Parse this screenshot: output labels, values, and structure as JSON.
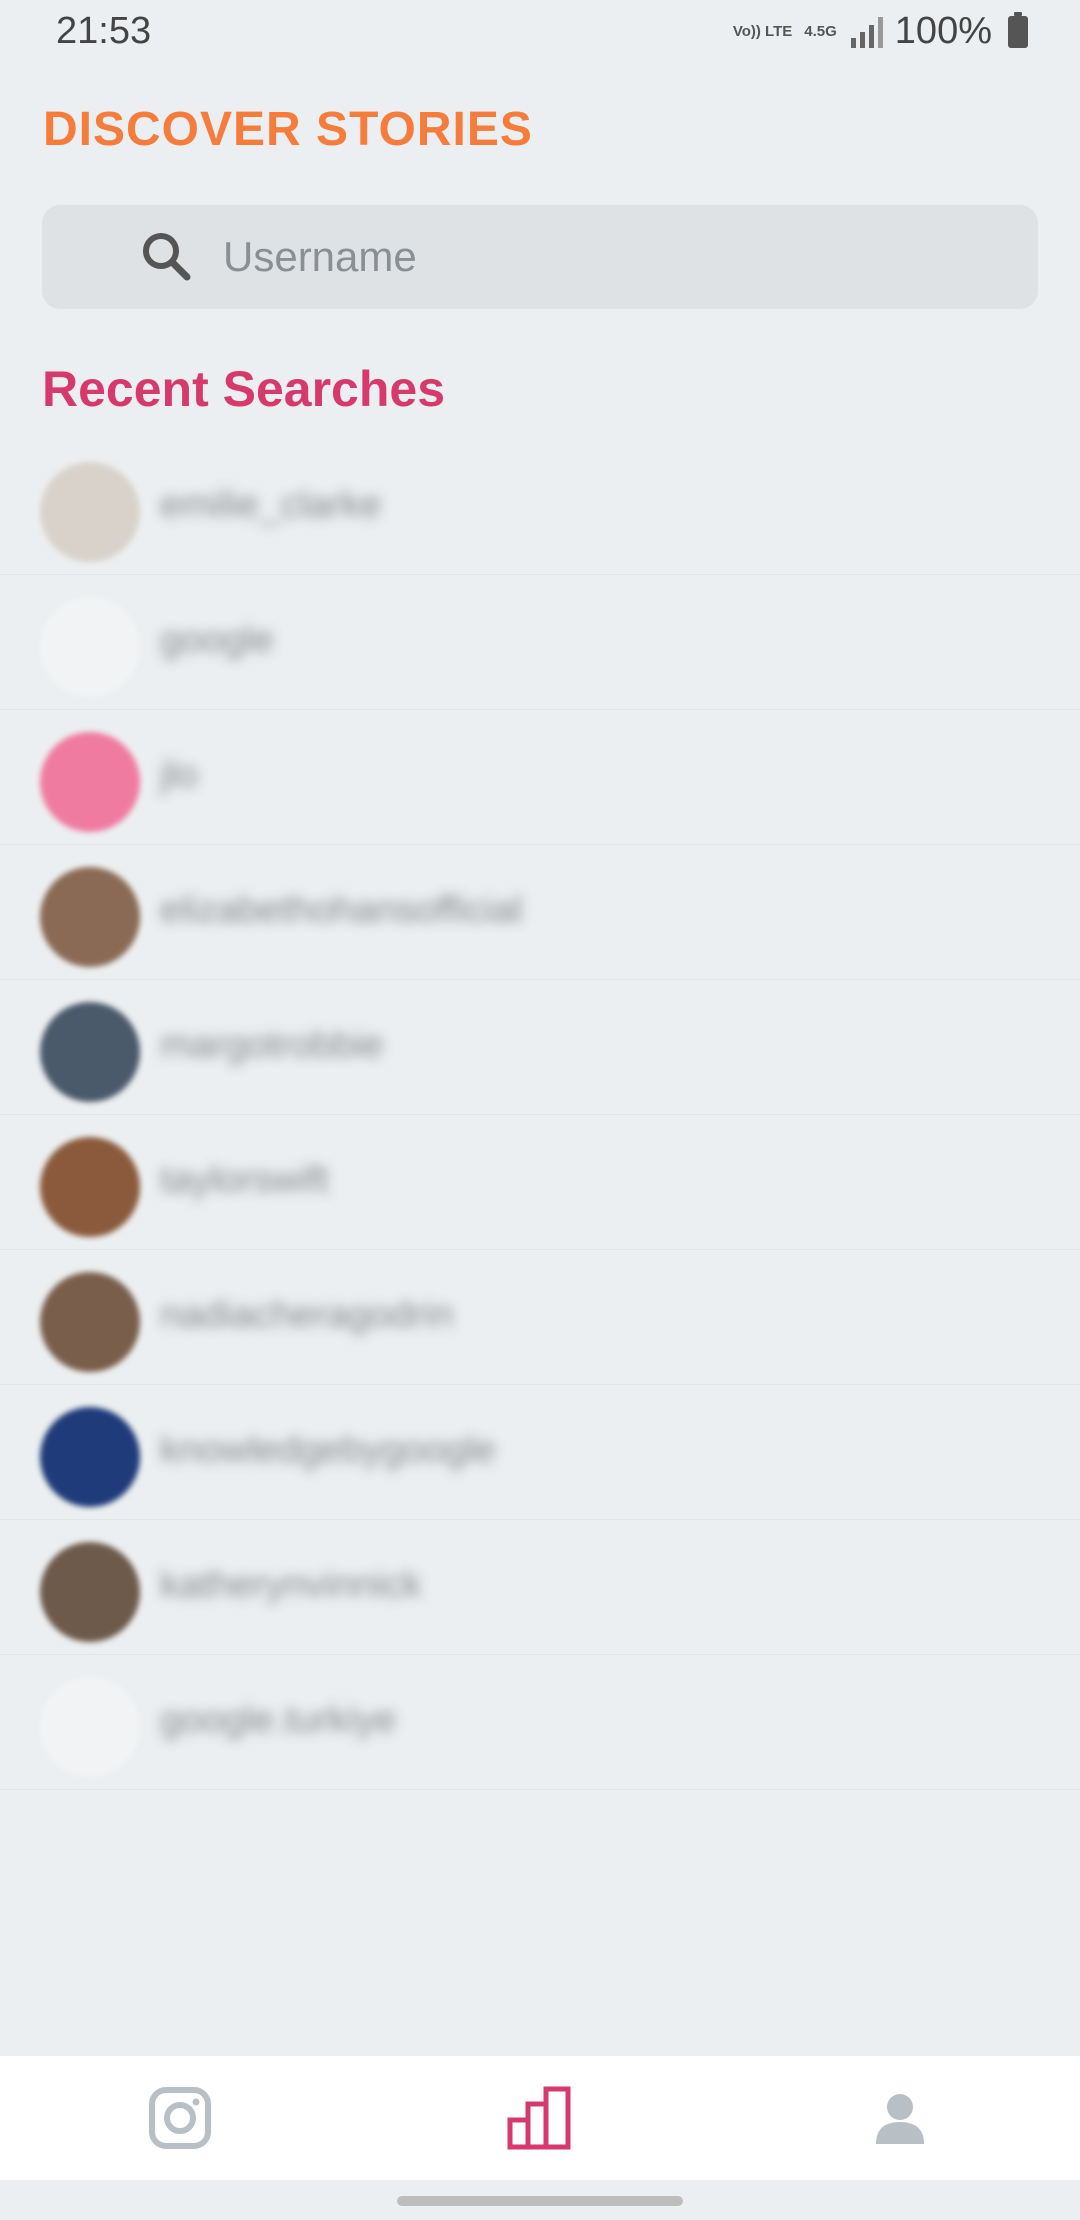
{
  "status_bar": {
    "time": "21:53",
    "volte": "Vo)) LTE",
    "network": "4.5G",
    "battery": "100%"
  },
  "header": {
    "title": "DISCOVER STORIES"
  },
  "search": {
    "placeholder": "Username"
  },
  "recent": {
    "title": "Recent Searches",
    "items": [
      {
        "username": "emilie_clarke",
        "avatar_color": "#d9d2cb"
      },
      {
        "username": "google",
        "avatar_color": "#f1f3f4"
      },
      {
        "username": "jlo",
        "avatar_color": "#f07ba0"
      },
      {
        "username": "elizabethohansofficial",
        "avatar_color": "#8a6a55"
      },
      {
        "username": "margotrobbie",
        "avatar_color": "#4b5a6b"
      },
      {
        "username": "taylorswift",
        "avatar_color": "#8b5a3c"
      },
      {
        "username": "nadiacheragodrin",
        "avatar_color": "#7a5e4c"
      },
      {
        "username": "knowledgebygoogle",
        "avatar_color": "#1f3b7a"
      },
      {
        "username": "katherynvinnick",
        "avatar_color": "#6e5a4b"
      },
      {
        "username": "google.turkiye",
        "avatar_color": "#f1f3f4"
      }
    ]
  },
  "bottom_nav": {
    "items": [
      {
        "name": "instagram",
        "color": "#b8c0c6"
      },
      {
        "name": "stats",
        "color": "#d63a6d"
      },
      {
        "name": "profile",
        "color": "#b8c0c6"
      }
    ]
  }
}
